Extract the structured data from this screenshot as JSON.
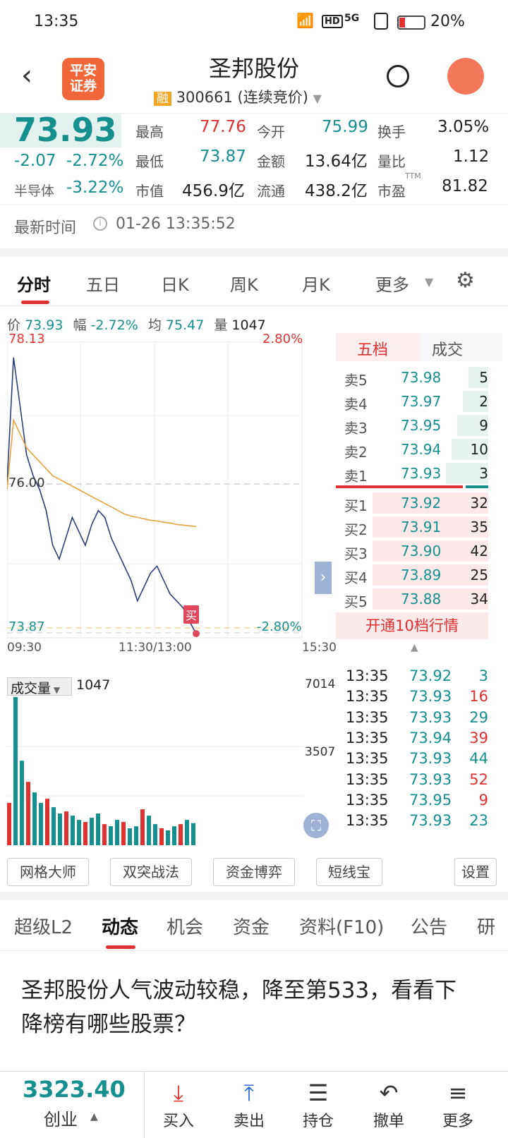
{
  "status": {
    "time": "13:35",
    "battery": "20%",
    "hd": "HD",
    "net": "5G"
  },
  "header": {
    "logo_line1": "平安",
    "logo_line2": "证券",
    "title": "圣邦股份",
    "rong": "融",
    "code": "300661 (连续竞价)"
  },
  "quote": {
    "price": "73.93",
    "change": "-2.07",
    "pct": "-2.72%",
    "sector_label": "半导体",
    "sector_pct": "-3.22%",
    "high_l": "最高",
    "high": "77.76",
    "open_l": "今开",
    "open": "75.99",
    "turn_l": "换手",
    "turn": "3.05%",
    "low_l": "最低",
    "low": "73.87",
    "amt_l": "金额",
    "amt": "13.64亿",
    "vr_l": "量比",
    "vr": "1.12",
    "cap_l": "市值",
    "cap": "456.9亿",
    "float_l": "流通",
    "float": "438.2亿",
    "pe_l": "市盈",
    "pe_sup": "TTM",
    "pe": "81.82"
  },
  "time_row": {
    "label": "最新时间",
    "value": "01-26 13:35:52"
  },
  "tabs": [
    "分时",
    "五日",
    "日K",
    "周K",
    "月K",
    "更多"
  ],
  "price_row": {
    "p_l": "价",
    "p": "73.93",
    "f_l": "幅",
    "f": "-2.72%",
    "a_l": "均",
    "a": "75.47",
    "v_l": "量",
    "v": "1047"
  },
  "chart": {
    "top_price": "78.13",
    "top_pct": "2.80%",
    "mid": "76.00",
    "bot_price": "73.87",
    "bot_pct": "-2.80%",
    "t0": "09:30",
    "t1": "11:30/13:00",
    "t2": "15:30",
    "buy_tag": "买"
  },
  "chart_data": {
    "type": "line",
    "x_labels": [
      "09:30",
      "11:30/13:00",
      "15:30"
    ],
    "ylim": [
      73.87,
      78.13
    ],
    "series": [
      {
        "values": [
          76.1,
          77.9,
          77.2,
          76.5,
          76.2,
          76.0,
          75.7,
          75.2,
          75.0,
          75.3,
          75.6,
          75.4,
          75.2,
          75.5,
          75.7,
          75.6,
          75.3,
          75.1,
          74.9,
          74.7,
          74.4,
          74.6,
          74.8,
          74.9,
          74.7,
          74.5,
          74.4,
          74.3,
          74.1,
          73.93
        ]
      },
      {
        "values": [
          76.0,
          77.0,
          76.8,
          76.6,
          76.5,
          76.4,
          76.3,
          76.2,
          76.15,
          76.1,
          76.05,
          76.0,
          75.95,
          75.9,
          75.85,
          75.8,
          75.75,
          75.7,
          75.65,
          75.62,
          75.6,
          75.58,
          75.56,
          75.55,
          75.53,
          75.52,
          75.5,
          75.49,
          75.48,
          75.47
        ]
      }
    ],
    "volume": [
      2000,
      7014,
      4000,
      3000,
      2500,
      2000,
      2200,
      1800,
      1500,
      1600,
      1400,
      1200,
      1100,
      1300,
      1500,
      1000,
      900,
      1200,
      1100,
      800,
      900,
      1700,
      1400,
      1000,
      800,
      700,
      900,
      1000,
      1200,
      1047
    ],
    "vol_labels": [
      "7014",
      "3507"
    ]
  },
  "orderbook": {
    "tab1": "五档",
    "tab2": "成交",
    "sell": [
      [
        "卖5",
        "73.98",
        "5"
      ],
      [
        "卖4",
        "73.97",
        "2"
      ],
      [
        "卖3",
        "73.95",
        "9"
      ],
      [
        "卖2",
        "73.94",
        "10"
      ],
      [
        "卖1",
        "73.93",
        "3"
      ]
    ],
    "buy": [
      [
        "买1",
        "73.92",
        "32"
      ],
      [
        "买2",
        "73.91",
        "35"
      ],
      [
        "买3",
        "73.90",
        "42"
      ],
      [
        "买4",
        "73.89",
        "25"
      ],
      [
        "买5",
        "73.88",
        "34"
      ]
    ],
    "open10": "开通10档行情"
  },
  "vol": {
    "label": "成交量",
    "value": "1047"
  },
  "trades": [
    [
      "13:35",
      "73.92",
      "3",
      "g"
    ],
    [
      "13:35",
      "73.93",
      "16",
      "r"
    ],
    [
      "13:35",
      "73.93",
      "29",
      "g"
    ],
    [
      "13:35",
      "73.94",
      "39",
      "r"
    ],
    [
      "13:35",
      "73.93",
      "44",
      "g"
    ],
    [
      "13:35",
      "73.93",
      "52",
      "r"
    ],
    [
      "13:35",
      "73.95",
      "9",
      "r"
    ],
    [
      "13:35",
      "73.93",
      "23",
      "g"
    ]
  ],
  "tools": [
    "网格大师",
    "双突战法",
    "资金博弈",
    "短线宝",
    "设置"
  ],
  "sec_tabs": [
    "超级L2",
    "动态",
    "机会",
    "资金",
    "资料(F10)",
    "公告",
    "研"
  ],
  "news": {
    "title": "圣邦股份人气波动较稳，降至第533，看看下降榜有哪些股票？"
  },
  "bottom": {
    "index_value": "3323.40",
    "index_name": "创业",
    "nav": [
      "买入",
      "卖出",
      "持仓",
      "撤单",
      "更多"
    ]
  }
}
